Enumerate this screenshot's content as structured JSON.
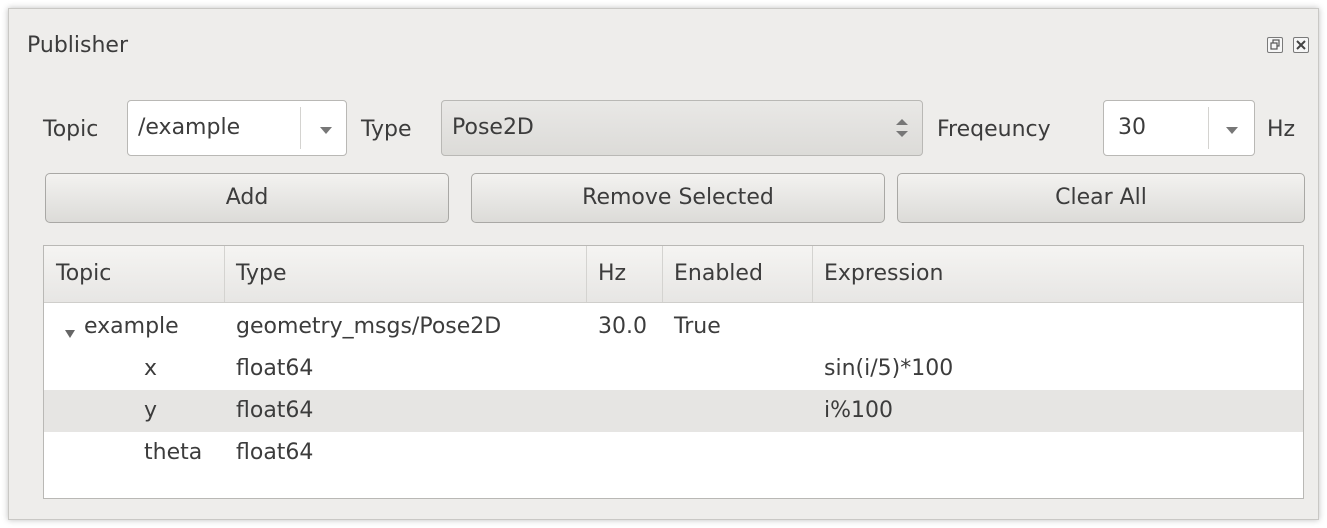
{
  "window": {
    "title": "Publisher"
  },
  "controls": {
    "topic_label": "Topic",
    "topic_value": "/example",
    "type_label": "Type",
    "type_value": "Pose2D",
    "frequency_label": "Freqeuncy",
    "frequency_value": "30",
    "unit_label": "Hz"
  },
  "buttons": {
    "add": "Add",
    "remove_selected": "Remove Selected",
    "clear_all": "Clear All"
  },
  "table": {
    "headers": [
      "Topic",
      "Type",
      "Hz",
      "Enabled",
      "Expression"
    ],
    "rows": [
      {
        "topic": "example",
        "type": "geometry_msgs/Pose2D",
        "hz": "30.0",
        "enabled": "True",
        "expression": ""
      },
      {
        "topic": "x",
        "type": "float64",
        "hz": "",
        "enabled": "",
        "expression": "sin(i/5)*100"
      },
      {
        "topic": "y",
        "type": "float64",
        "hz": "",
        "enabled": "",
        "expression": "i%100"
      },
      {
        "topic": "theta",
        "type": "float64",
        "hz": "",
        "enabled": "",
        "expression": ""
      }
    ]
  },
  "icons": {
    "float": "restore-icon",
    "close": "close-icon",
    "expand": "triangle-down-icon"
  },
  "colors": {
    "window_bg": "#eeedeb",
    "selected_row": "#e6e5e3"
  }
}
